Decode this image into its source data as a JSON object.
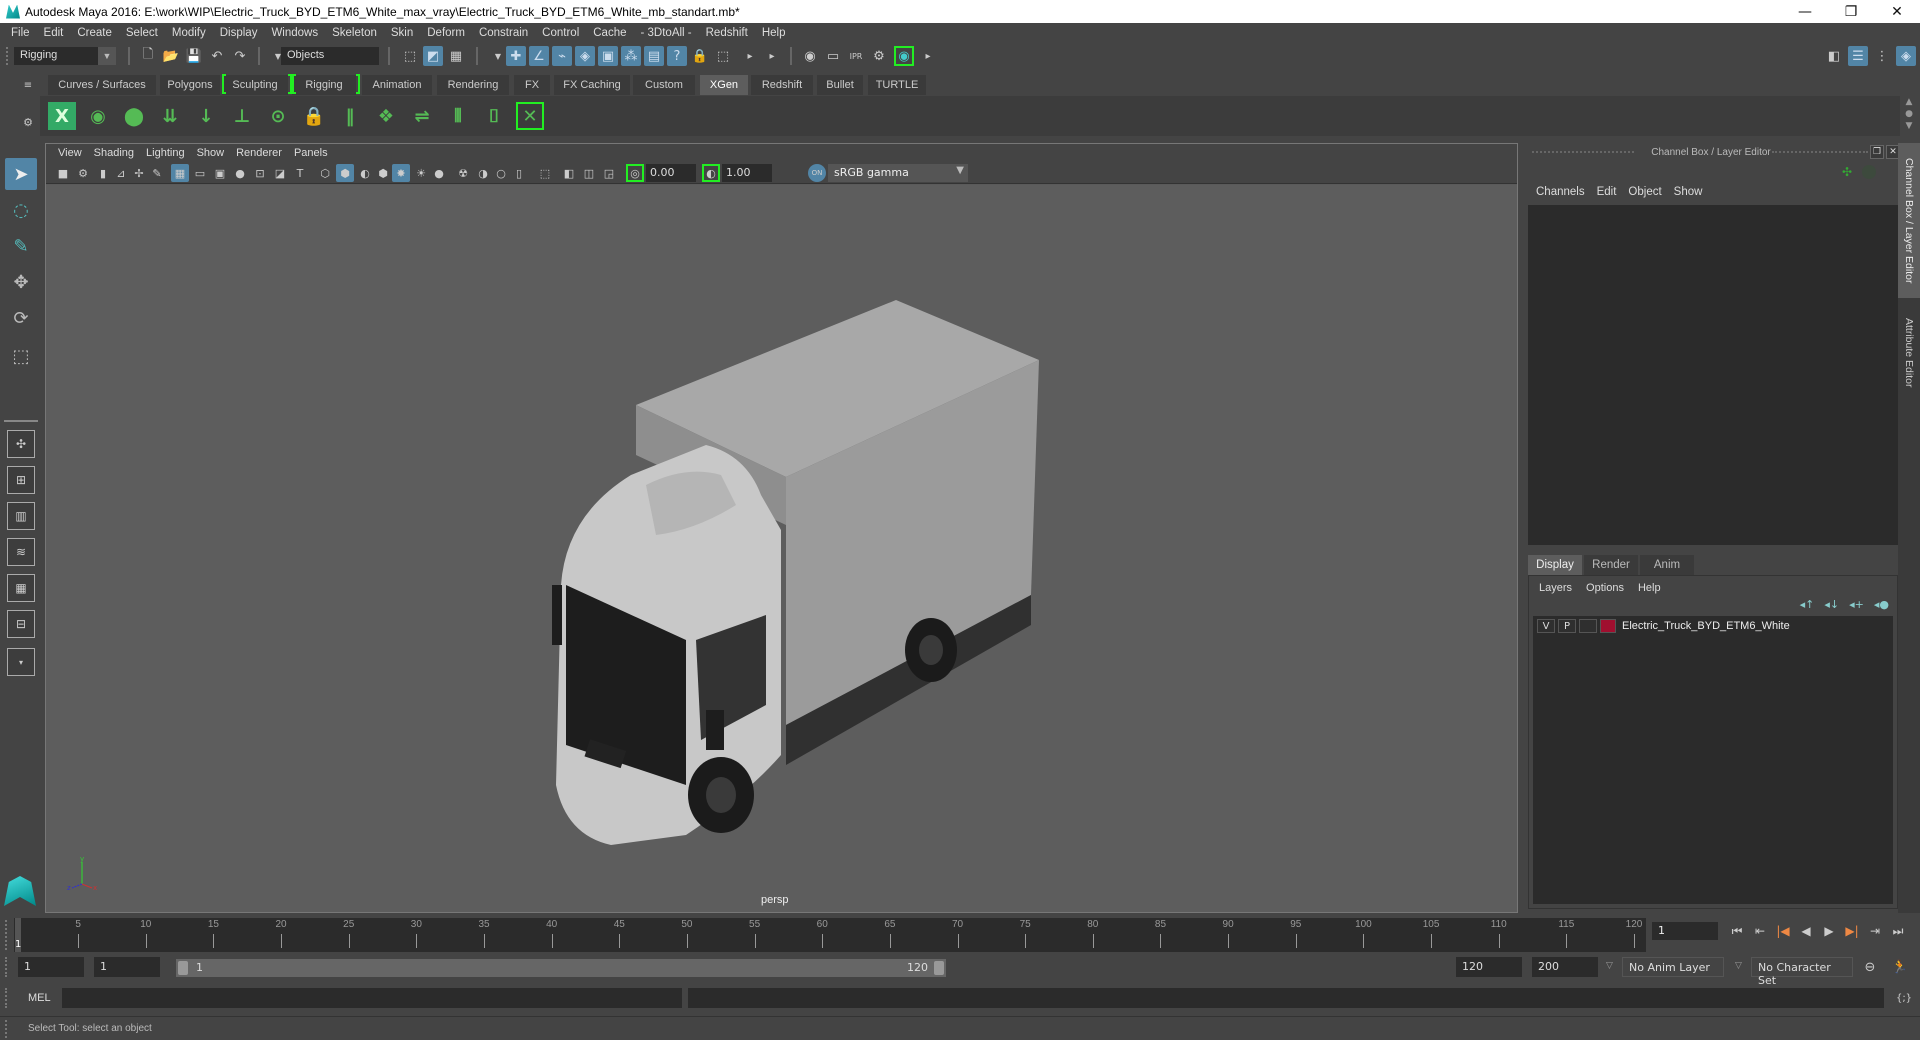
{
  "window": {
    "title": "Autodesk Maya 2016: E:\\work\\WIP\\Electric_Truck_BYD_ETM6_White_max_vray\\Electric_Truck_BYD_ETM6_White_mb_standart.mb*",
    "controls": {
      "minimize": "—",
      "restore": "❐",
      "close": "✕"
    }
  },
  "menubar": [
    "File",
    "Edit",
    "Create",
    "Select",
    "Modify",
    "Display",
    "Windows",
    "Skeleton",
    "Skin",
    "Deform",
    "Constrain",
    "Control",
    "Cache",
    "- 3DtoAll -",
    "Redshift",
    "Help"
  ],
  "statusline": {
    "mode": "Rigging",
    "selection_mask": "Objects"
  },
  "shelf": {
    "tabs": [
      "Curves / Surfaces",
      "Polygons",
      "Sculpting",
      "Rigging",
      "Animation",
      "Rendering",
      "FX",
      "FX Caching",
      "Custom",
      "XGen",
      "Redshift",
      "Bullet",
      "TURTLE"
    ],
    "active_tab": "XGen",
    "icons": [
      "xgen-editor",
      "toggle-preview",
      "clear-preview",
      "add-guides",
      "place-guide",
      "add-guide",
      "sculpt-guide",
      "lock-guide",
      "guide-to-curves",
      "xgen-primitives",
      "flip-guide",
      "select-guides",
      "guide-tool",
      "xgen-toggle"
    ]
  },
  "viewport": {
    "menu": [
      "View",
      "Shading",
      "Lighting",
      "Show",
      "Renderer",
      "Panels"
    ],
    "exposure": "0.00",
    "gamma": "1.00",
    "color_space": "sRGB gamma",
    "camera_label": "persp",
    "axis_labels": {
      "x": "x",
      "y": "y",
      "z": "z"
    }
  },
  "channel_box": {
    "title": "Channel Box / Layer Editor",
    "menu": [
      "Channels",
      "Edit",
      "Object",
      "Show"
    ]
  },
  "layer_editor": {
    "tabs": [
      "Display",
      "Render",
      "Anim"
    ],
    "active_tab": "Display",
    "menu": [
      "Layers",
      "Options",
      "Help"
    ],
    "layers": [
      {
        "visible": "V",
        "playback": "P",
        "name": "Electric_Truck_BYD_ETM6_White",
        "color": "#a00f2f"
      }
    ]
  },
  "side_tabs": [
    "Channel Box / Layer Editor",
    "Attribute Editor"
  ],
  "timeline": {
    "ticks": [
      5,
      10,
      15,
      20,
      25,
      30,
      35,
      40,
      45,
      50,
      55,
      60,
      65,
      70,
      75,
      80,
      85,
      90,
      95,
      100,
      105,
      110,
      115,
      120
    ],
    "min": 1,
    "max": 120,
    "current_frame": "1",
    "current_frame_field": "1"
  },
  "range": {
    "start": "1",
    "playback_start": "1",
    "slider_start": "1",
    "slider_end": "120",
    "playback_end": "120",
    "end": "200",
    "anim_layer": "No Anim Layer",
    "character_set": "No Character Set"
  },
  "playback_controls": [
    "go-to-start",
    "step-back-frame",
    "step-back-key",
    "play-backwards",
    "play-forwards",
    "step-forward-key",
    "step-forward-frame",
    "go-to-end"
  ],
  "command_line": {
    "label": "MEL",
    "value": ""
  },
  "help_line": "Select Tool: select an object"
}
